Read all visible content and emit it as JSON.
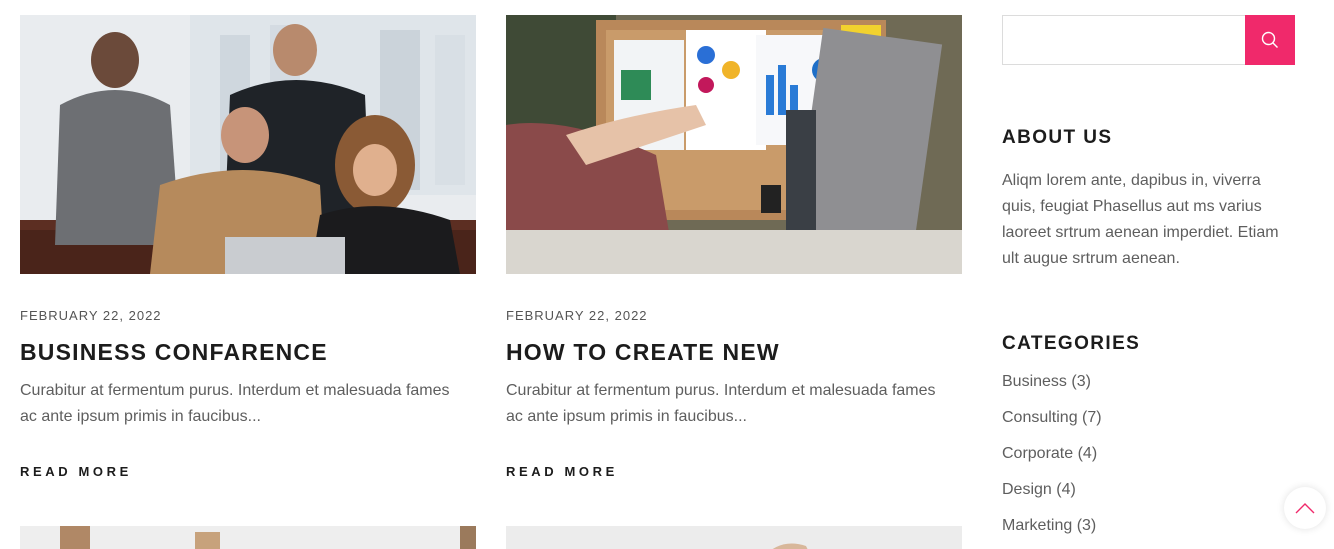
{
  "posts": [
    {
      "date": "FEBRUARY 22, 2022",
      "title": "BUSINESS CONFARENCE",
      "excerpt": "Curabitur at fermentum purus. Interdum et malesuada fames ac ante ipsum primis in faucibus...",
      "read_more": "READ MORE",
      "image": "business-team-laptop-photo"
    },
    {
      "date": "FEBRUARY 22, 2022",
      "title": "HOW TO CREATE NEW",
      "excerpt": "Curabitur at fermentum purus. Interdum et malesuada fames ac ante ipsum primis in faucibus...",
      "read_more": "READ MORE",
      "image": "charts-on-corkboard-photo"
    }
  ],
  "sidebar": {
    "search": {
      "placeholder": "",
      "value": "",
      "icon": "search-icon"
    },
    "about": {
      "title": "ABOUT US",
      "text": "Aliqm lorem ante, dapibus in, viverra quis, feugiat Phasellus aut ms varius laoreet srtrum aenean imperdiet. Etiam ult augue srtrum aenean."
    },
    "categories": {
      "title": "CATEGORIES",
      "items": [
        {
          "label": "Business (3)"
        },
        {
          "label": "Consulting (7)"
        },
        {
          "label": "Corporate (4)"
        },
        {
          "label": "Design (4)"
        },
        {
          "label": "Marketing (3)"
        }
      ]
    }
  },
  "scroll_top": {
    "icon": "chevron-up-icon"
  },
  "colors": {
    "accent": "#f0296b",
    "text": "#5e5e5e",
    "heading": "#1c1c1c"
  }
}
